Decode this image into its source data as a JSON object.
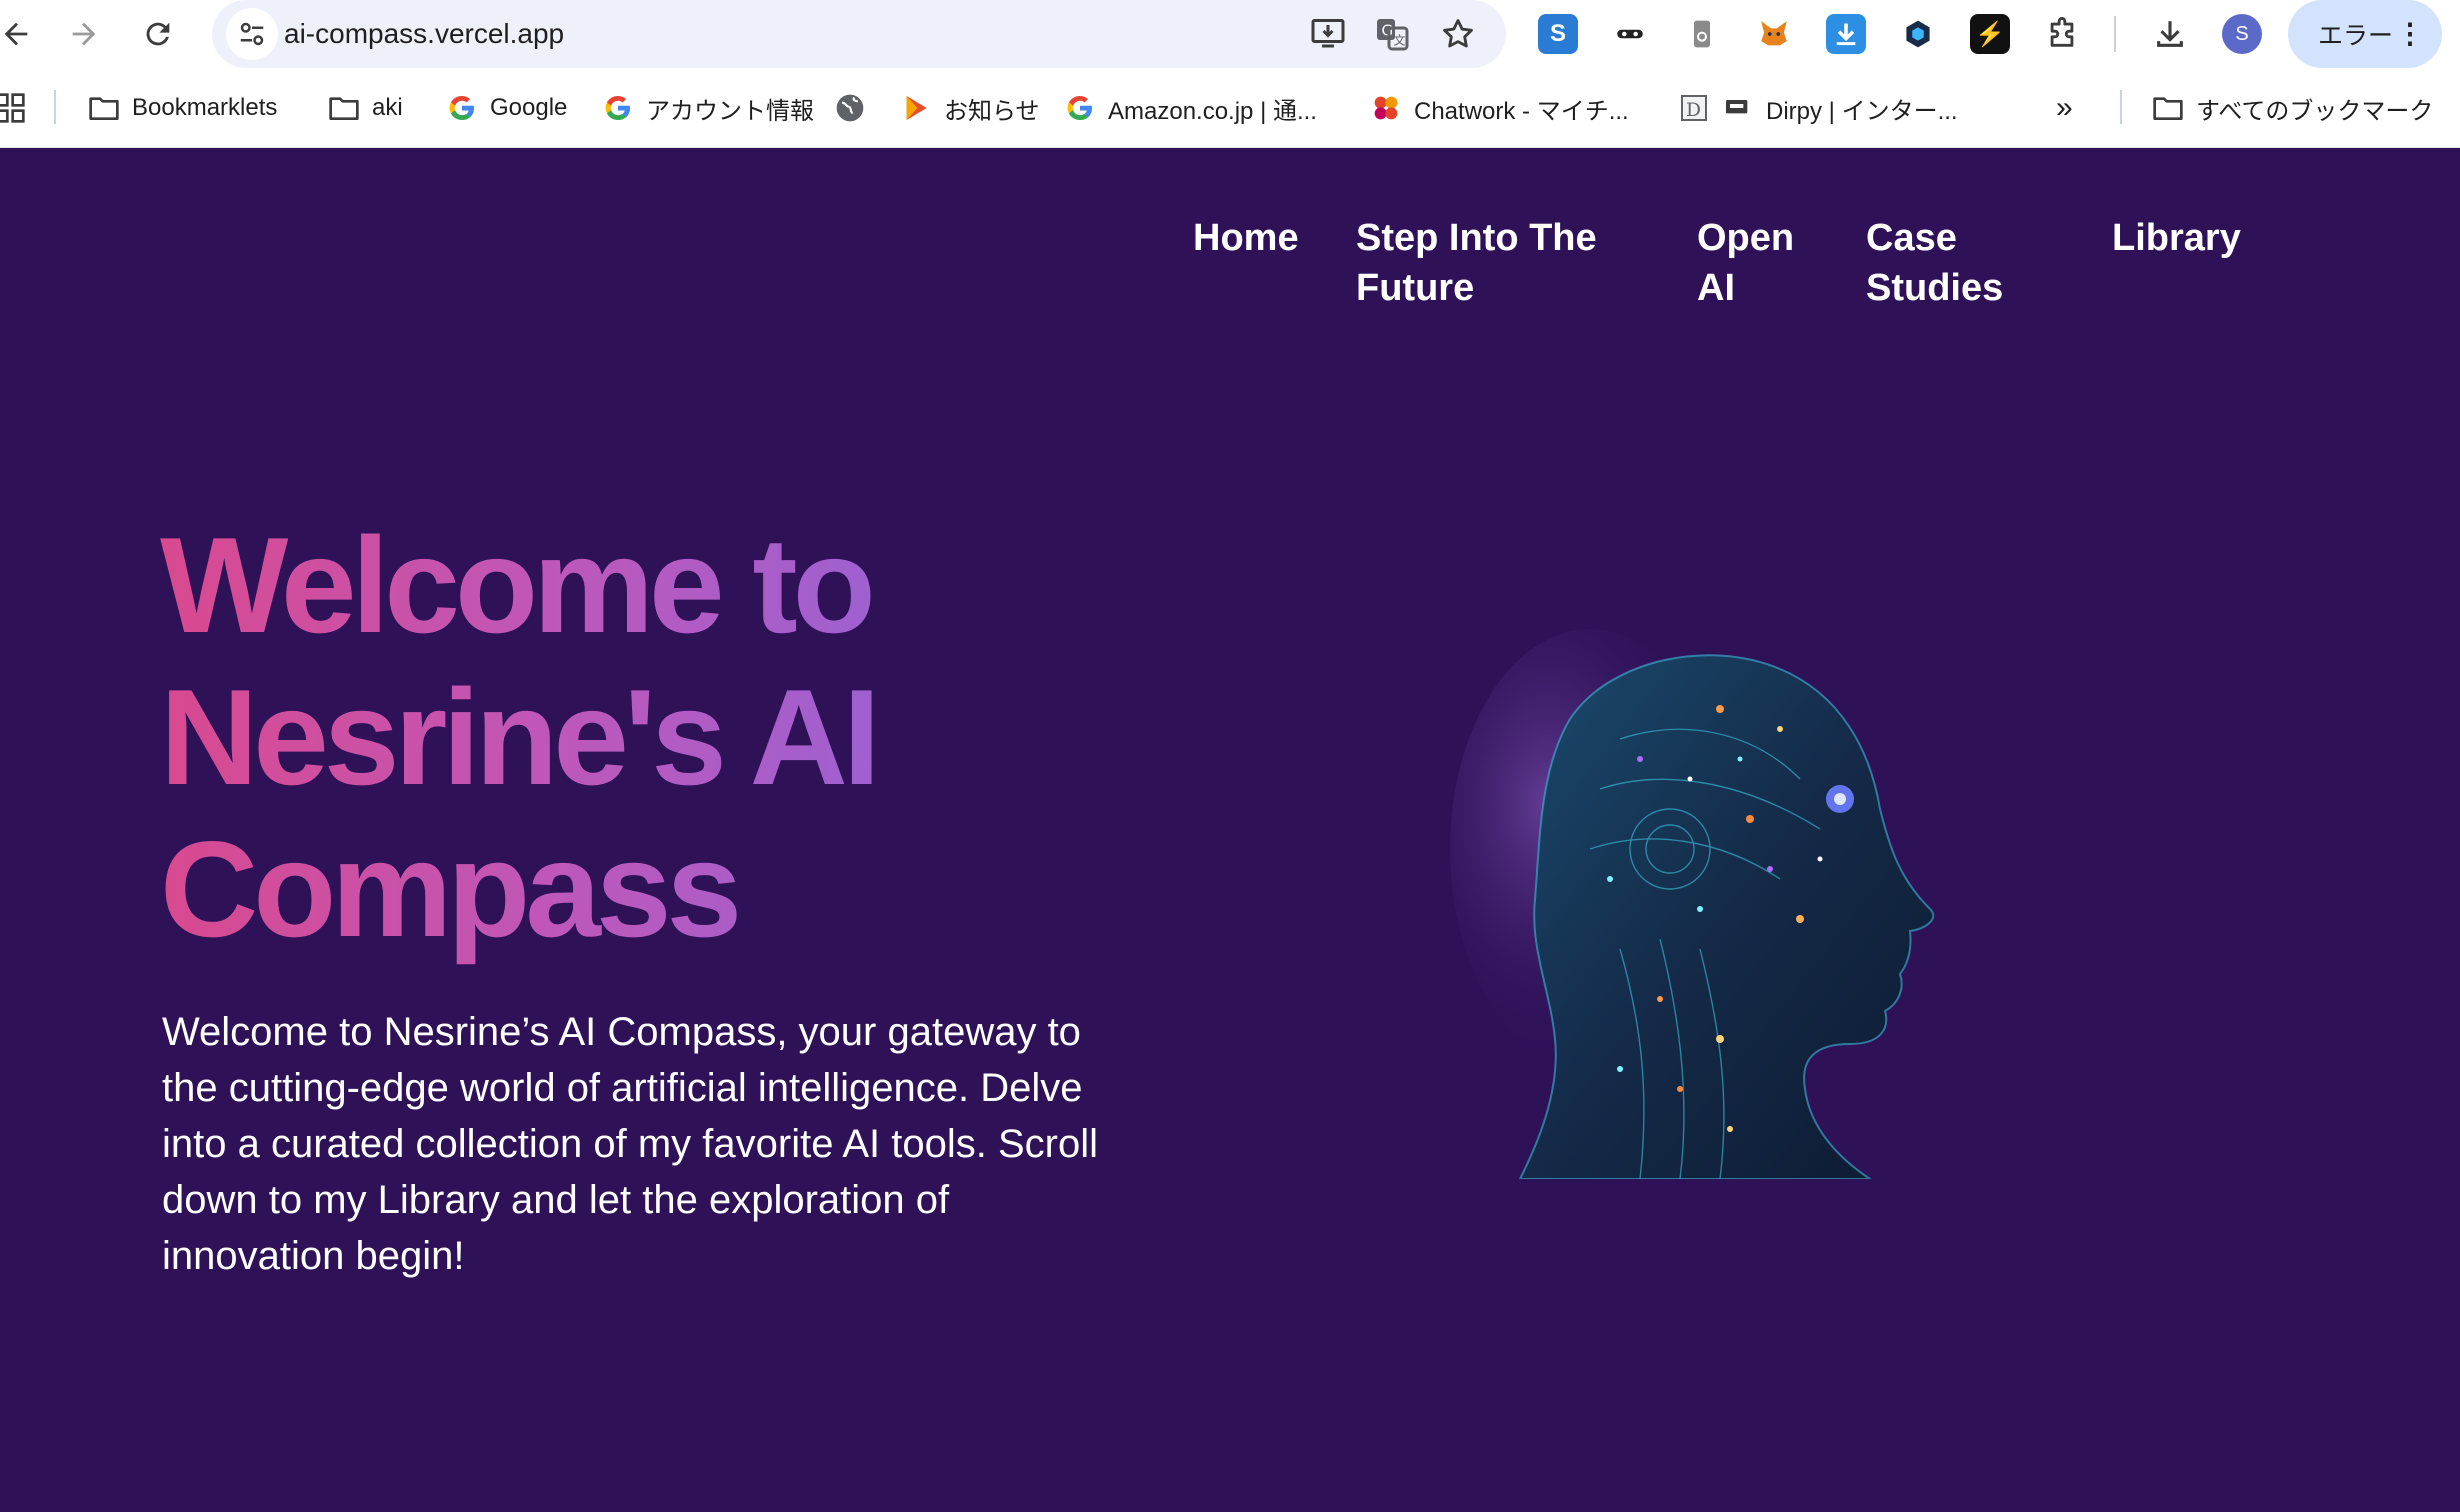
{
  "browser": {
    "url": "ai-compass.vercel.app",
    "profile_initial": "S",
    "error_chip": "エラー"
  },
  "bookmarks": [
    {
      "label": "Bookmarklets",
      "icon": "folder-icon"
    },
    {
      "label": "aki",
      "icon": "folder-icon"
    },
    {
      "label": "Google",
      "icon": "google-icon"
    },
    {
      "label": "アカウント情報",
      "icon": "google-icon"
    },
    {
      "label": "",
      "icon": "globe-icon"
    },
    {
      "label": "お知らせ",
      "icon": "play-icon"
    },
    {
      "label": "Amazon.co.jp | 通...",
      "icon": "google-icon"
    },
    {
      "label": "Chatwork - マイチ...",
      "icon": "chatwork-icon"
    },
    {
      "label": "",
      "icon": "dirpy-icon"
    },
    {
      "label": "Dirpy | インター...",
      "icon": "dirpy-small-icon"
    },
    {
      "label": "すべてのブックマーク",
      "icon": "folder-icon"
    }
  ],
  "nav": {
    "home": "Home",
    "step_line1": "Step Into The",
    "step_line2": "Future",
    "openai_line1": "Open",
    "openai_line2": "AI",
    "case_line1": "Case",
    "case_line2": "Studies",
    "library": "Library"
  },
  "hero": {
    "title_line1": "Welcome to",
    "title_line2": "Nesrine's AI",
    "title_line3": "Compass",
    "description_line1": "Welcome to Nesrine’s AI Compass, your gateway to",
    "description_line2": "the cutting-edge world of artificial intelligence. Delve",
    "description_line3": "into a curated collection of my favorite AI tools. Scroll",
    "description_line4": "down to my Library and let the exploration of",
    "description_line5": "innovation begin!"
  },
  "colors": {
    "page_bg": "#2e1157",
    "title_gradient_start": "#d9498f",
    "title_gradient_end": "#9a62d4"
  }
}
